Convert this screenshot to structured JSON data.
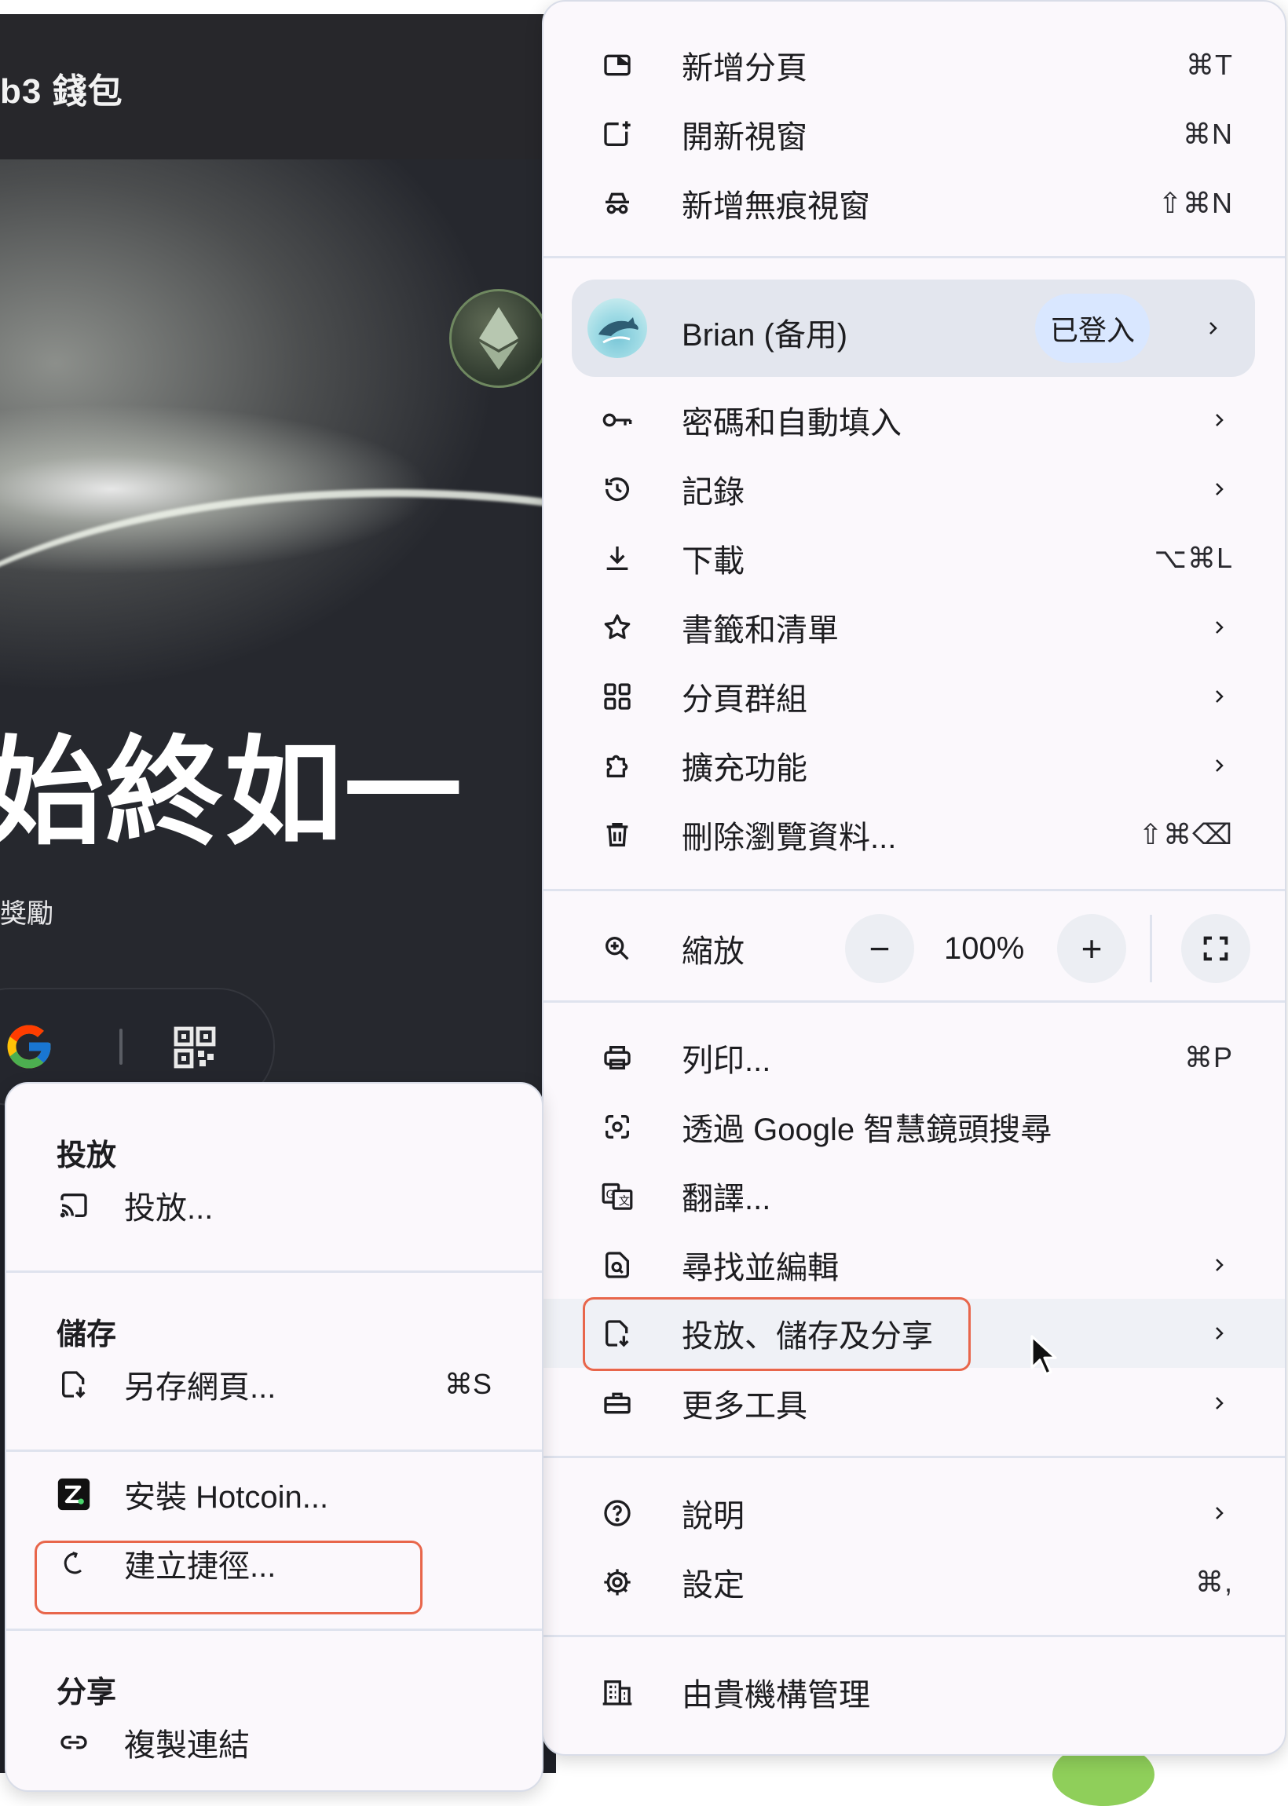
{
  "background_page": {
    "logo_text": "b3 錢包",
    "hero_title": "始終如一",
    "hero_subtitle": "獎勵"
  },
  "menu": {
    "top_items": [
      {
        "label": "新增分頁",
        "shortcut": "⌘T",
        "icon": "new-tab-icon"
      },
      {
        "label": "開新視窗",
        "shortcut": "⌘N",
        "icon": "new-window-icon"
      },
      {
        "label": "新增無痕視窗",
        "shortcut": "⇧⌘N",
        "icon": "incognito-icon"
      }
    ],
    "profile": {
      "name": "Brian (备用)",
      "status": "已登入"
    },
    "mid_items": [
      {
        "label": "密碼和自動填入",
        "shortcut": "",
        "icon": "key-icon",
        "submenu": true
      },
      {
        "label": "記錄",
        "shortcut": "",
        "icon": "history-icon",
        "submenu": true
      },
      {
        "label": "下載",
        "shortcut": "⌥⌘L",
        "icon": "download-icon",
        "submenu": false
      },
      {
        "label": "書籤和清單",
        "shortcut": "",
        "icon": "star-icon",
        "submenu": true
      },
      {
        "label": "分頁群組",
        "shortcut": "",
        "icon": "tab-groups-icon",
        "submenu": true
      },
      {
        "label": "擴充功能",
        "shortcut": "",
        "icon": "extension-icon",
        "submenu": true
      },
      {
        "label": "刪除瀏覽資料...",
        "shortcut": "⇧⌘⌫",
        "icon": "trash-icon",
        "submenu": false
      }
    ],
    "zoom": {
      "label": "縮放",
      "value": "100%",
      "minus": "−",
      "plus": "+"
    },
    "tool_items": [
      {
        "label": "列印...",
        "shortcut": "⌘P",
        "icon": "print-icon",
        "submenu": false
      },
      {
        "label": "透過 Google 智慧鏡頭搜尋",
        "shortcut": "",
        "icon": "lens-icon",
        "submenu": false
      },
      {
        "label": "翻譯...",
        "shortcut": "",
        "icon": "translate-icon",
        "submenu": false
      },
      {
        "label": "尋找並編輯",
        "shortcut": "",
        "icon": "find-icon",
        "submenu": true
      },
      {
        "label": "投放、儲存及分享",
        "shortcut": "",
        "icon": "save-share-icon",
        "submenu": true
      },
      {
        "label": "更多工具",
        "shortcut": "",
        "icon": "toolbox-icon",
        "submenu": true
      }
    ],
    "help_items": [
      {
        "label": "說明",
        "shortcut": "",
        "icon": "help-icon",
        "submenu": true
      },
      {
        "label": "設定",
        "shortcut": "⌘,",
        "icon": "gear-icon",
        "submenu": false
      }
    ],
    "managed": {
      "label": "由貴機構管理",
      "icon": "building-icon"
    }
  },
  "submenu": {
    "cast_header": "投放",
    "cast_item": "投放...",
    "save_header": "儲存",
    "save_item": "另存網頁...",
    "save_shortcut": "⌘S",
    "install_item": "安裝 Hotcoin...",
    "shortcut_item": "建立捷徑...",
    "share_header": "分享",
    "copy_link_item": "複製連結"
  }
}
